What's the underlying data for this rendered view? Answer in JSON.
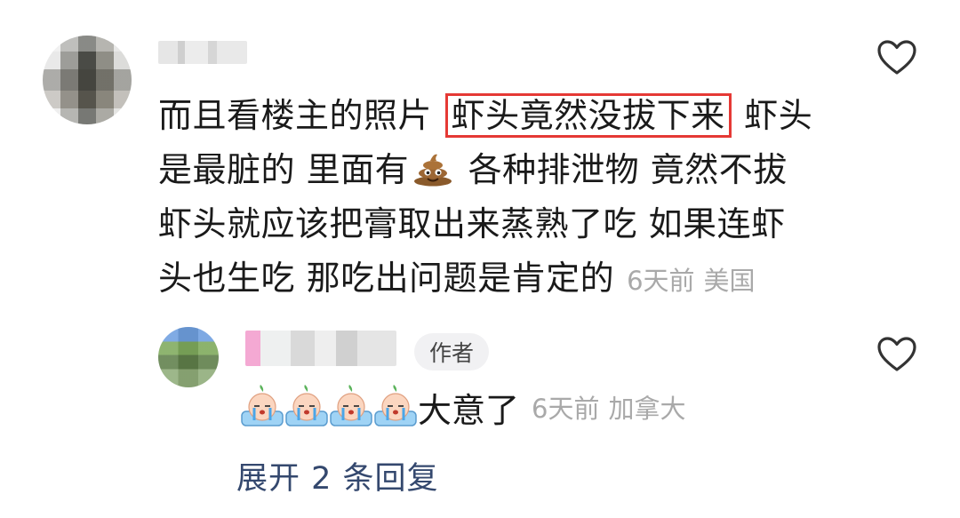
{
  "comment": {
    "text_before": "而且看楼主的照片 ",
    "highlighted": "虾头竟然没拔下来",
    "text_mid": " 虾头是最脏的 里面有",
    "emoji": "poop-emoji",
    "text_after": " 各种排泄物 竟然不拔虾头就应该把膏取出来蒸熟了吃 如果连虾头也生吃 那吃出问题是肯定的",
    "time": "6天前",
    "location": "美国",
    "like_icon": "heart-outline-icon"
  },
  "reply": {
    "author_badge": "作者",
    "emoji_count": 4,
    "emoji": "crying-face-sticker",
    "text": "大意了",
    "time": "6天前",
    "location": "加拿大",
    "like_icon": "heart-outline-icon"
  },
  "expand_replies": "展开 2 条回复",
  "colors": {
    "highlight_border": "#e53935",
    "meta_text": "#a9a9a9",
    "link_text": "#34486e"
  }
}
